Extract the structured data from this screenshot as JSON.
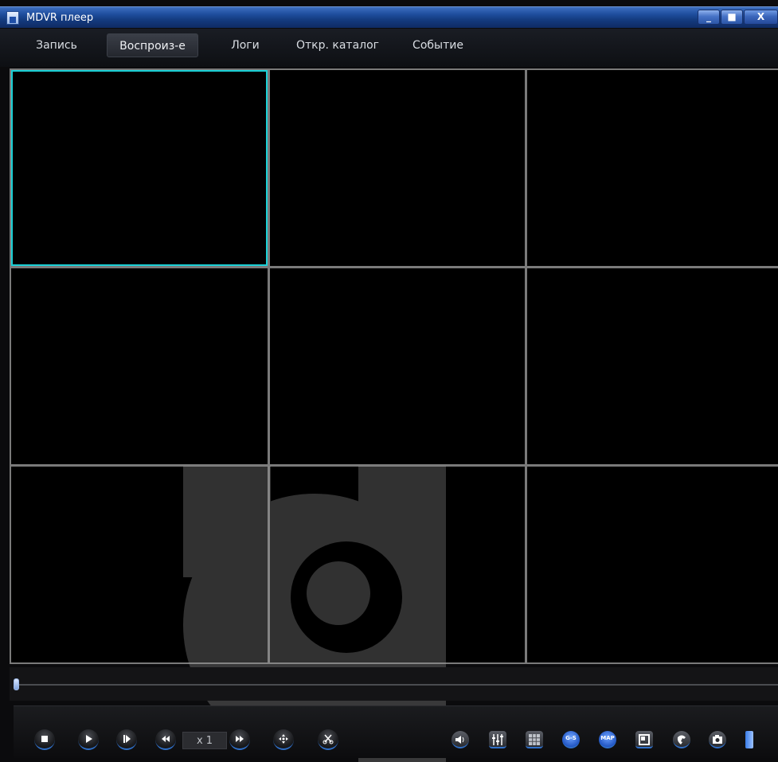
{
  "window": {
    "title": "MDVR плеер",
    "controls": {
      "minimize": "_",
      "maximize": "■",
      "close": "X"
    }
  },
  "menu": {
    "items": [
      {
        "label": "Запись"
      },
      {
        "label": "Воспроиз-е",
        "active": true
      },
      {
        "label": "Логи"
      },
      {
        "label": "Откр. каталог"
      },
      {
        "label": "Событие"
      }
    ]
  },
  "video_grid": {
    "rows": 3,
    "columns": 3,
    "selected_cell": 1
  },
  "timeline": {
    "position": 0
  },
  "playback": {
    "speed": "x 1",
    "buttons": [
      "stop-icon",
      "play-icon",
      "frame-step-icon",
      "rewind-icon",
      "fast-forward-icon",
      "ptz-icon",
      "cut-icon"
    ],
    "tools": [
      "volume-icon",
      "equalizer-icon",
      "layout-grid-icon",
      "gps-icon",
      "map-icon",
      "window-icon",
      "phone-icon",
      "snapshot-icon",
      "storage-icon"
    ]
  },
  "colors": {
    "selection": "#1ad0d6",
    "titlebar": "#1e4d9d",
    "accent": "#2f6fc8"
  }
}
